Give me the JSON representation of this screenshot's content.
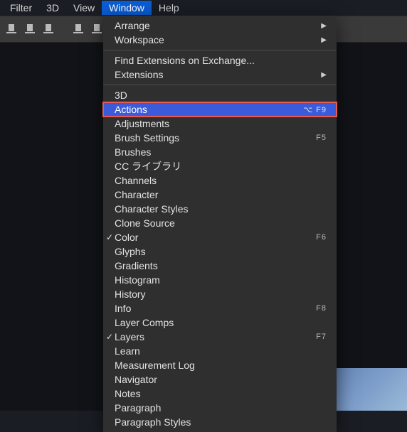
{
  "menubar": {
    "items": [
      {
        "label": "Filter",
        "active": false
      },
      {
        "label": "3D",
        "active": false
      },
      {
        "label": "View",
        "active": false
      },
      {
        "label": "Window",
        "active": true
      },
      {
        "label": "Help",
        "active": false
      }
    ]
  },
  "dropdown": {
    "groups": [
      [
        {
          "label": "Arrange",
          "submenu": true
        },
        {
          "label": "Workspace",
          "submenu": true
        }
      ],
      [
        {
          "label": "Find Extensions on Exchange..."
        },
        {
          "label": "Extensions",
          "submenu": true
        }
      ],
      [
        {
          "label": "3D"
        },
        {
          "label": "Actions",
          "shortcut": "⌥ F9",
          "highlight": true
        },
        {
          "label": "Adjustments"
        },
        {
          "label": "Brush Settings",
          "shortcut": "F5"
        },
        {
          "label": "Brushes"
        },
        {
          "label": "CC ライブラリ"
        },
        {
          "label": "Channels"
        },
        {
          "label": "Character"
        },
        {
          "label": "Character Styles"
        },
        {
          "label": "Clone Source"
        },
        {
          "label": "Color",
          "checked": true,
          "shortcut": "F6"
        },
        {
          "label": "Glyphs"
        },
        {
          "label": "Gradients"
        },
        {
          "label": "Histogram"
        },
        {
          "label": "History"
        },
        {
          "label": "Info",
          "shortcut": "F8"
        },
        {
          "label": "Layer Comps"
        },
        {
          "label": "Layers",
          "checked": true,
          "shortcut": "F7"
        },
        {
          "label": "Learn"
        },
        {
          "label": "Measurement Log"
        },
        {
          "label": "Navigator"
        },
        {
          "label": "Notes"
        },
        {
          "label": "Paragraph"
        },
        {
          "label": "Paragraph Styles"
        }
      ]
    ]
  }
}
